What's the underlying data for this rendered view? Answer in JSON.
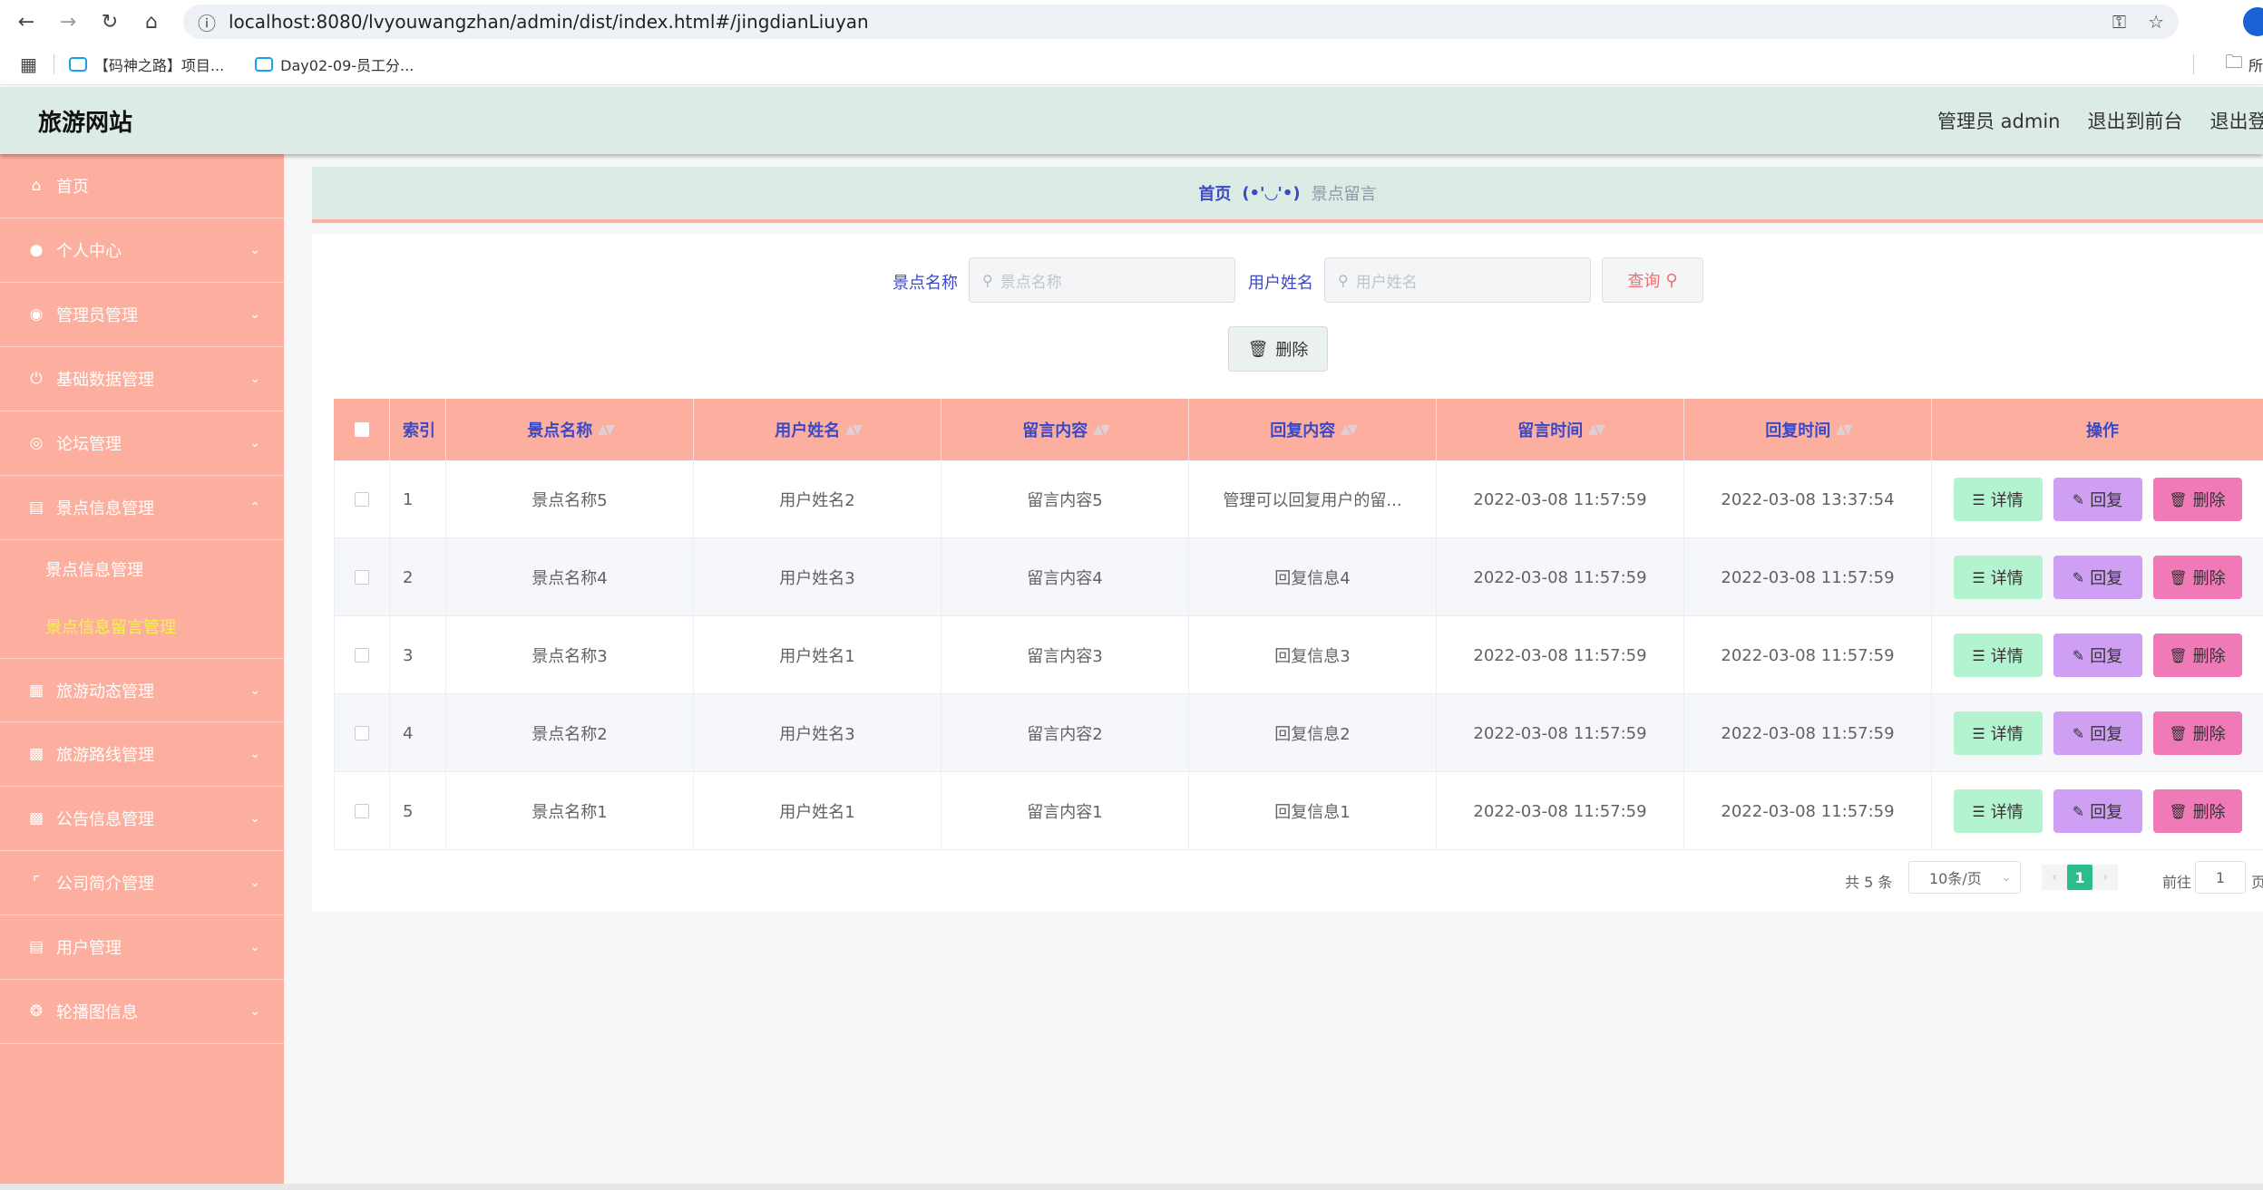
{
  "browser": {
    "url": "localhost:8080/lvyouwangzhan/admin/dist/index.html#/jingdianLiuyan",
    "bookmarks": [
      "【码神之路】项目...",
      "Day02-09-员工分..."
    ],
    "bookmark_right": "所"
  },
  "header": {
    "site_title": "旅游网站",
    "admin_label": "管理员 admin",
    "to_front": "退出到前台",
    "logout": "退出登录"
  },
  "sidebar": {
    "items": [
      {
        "label": "首页",
        "icon": "home-icon"
      },
      {
        "label": "个人中心",
        "icon": "user-icon"
      },
      {
        "label": "管理员管理",
        "icon": "bulb-icon"
      },
      {
        "label": "基础数据管理",
        "icon": "power-icon"
      },
      {
        "label": "论坛管理",
        "icon": "compass-icon"
      },
      {
        "label": "景点信息管理",
        "icon": "clipboard-icon"
      },
      {
        "label": "旅游动态管理",
        "icon": "grid-icon"
      },
      {
        "label": "旅游路线管理",
        "icon": "calendar-icon"
      },
      {
        "label": "公告信息管理",
        "icon": "bar-chart-icon"
      },
      {
        "label": "公司简介管理",
        "icon": "crop-icon"
      },
      {
        "label": "用户管理",
        "icon": "clipboard-check-icon"
      },
      {
        "label": "轮播图信息",
        "icon": "aperture-icon"
      }
    ],
    "sub_items": [
      "景点信息管理",
      "景点信息留言管理"
    ],
    "active_sub": "景点信息留言管理"
  },
  "breadcrumb": {
    "home": "首页",
    "separator": "(•'◡'•)",
    "current": "景点留言"
  },
  "search": {
    "name_label": "景点名称",
    "name_placeholder": "景点名称",
    "user_label": "用户姓名",
    "user_placeholder": "用户姓名",
    "query_label": "查询",
    "delete_label": "删除"
  },
  "table": {
    "columns": [
      "索引",
      "景点名称",
      "用户姓名",
      "留言内容",
      "回复内容",
      "留言时间",
      "回复时间",
      "操作"
    ],
    "rows": [
      [
        "1",
        "景点名称5",
        "用户姓名2",
        "留言内容5",
        "管理可以回复用户的留...",
        "2022-03-08 11:57:59",
        "2022-03-08 13:37:54"
      ],
      [
        "2",
        "景点名称4",
        "用户姓名3",
        "留言内容4",
        "回复信息4",
        "2022-03-08 11:57:59",
        "2022-03-08 11:57:59"
      ],
      [
        "3",
        "景点名称3",
        "用户姓名1",
        "留言内容3",
        "回复信息3",
        "2022-03-08 11:57:59",
        "2022-03-08 11:57:59"
      ],
      [
        "4",
        "景点名称2",
        "用户姓名3",
        "留言内容2",
        "回复信息2",
        "2022-03-08 11:57:59",
        "2022-03-08 11:57:59"
      ],
      [
        "5",
        "景点名称1",
        "用户姓名1",
        "留言内容1",
        "回复信息1",
        "2022-03-08 11:57:59",
        "2022-03-08 11:57:59"
      ]
    ],
    "actions": {
      "detail": "详情",
      "reply": "回复",
      "delete": "删除"
    }
  },
  "pagination": {
    "total": "共 5 条",
    "page_size": "10条/页",
    "current_page": "1",
    "goto_label": "前往",
    "goto_value": "1",
    "page_suffix": "页"
  },
  "colors": {
    "sidebar_bg": "#fdaf9f",
    "header_bg": "#dcebe3",
    "accent_text": "#3b49c6",
    "detail_btn": "#b3f3cf",
    "reply_btn": "#cf9ff4",
    "delete_btn": "#f07ab8",
    "pager_active": "#2bbd8e"
  }
}
